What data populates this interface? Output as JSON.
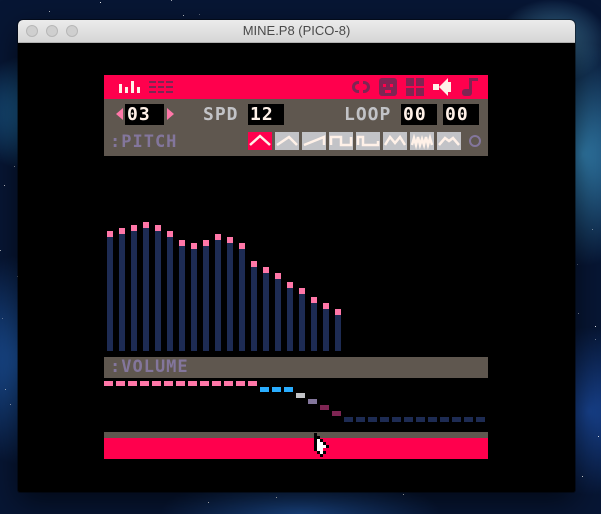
{
  "window": {
    "title": "MINE.P8 (PICO-8)"
  },
  "colors": {
    "red": "#ff004d",
    "dark_red": "#7e2553",
    "grey": "#5f574f",
    "light_grey": "#c2c3c7",
    "lavender": "#83769c",
    "white": "#fff1e8",
    "navy": "#1d2b53",
    "pink": "#ff77a8",
    "blue": "#29adff",
    "black": "#000000"
  },
  "toolbar": {
    "left_icons": [
      "sfx-editor-icon",
      "pattern-editor-icon"
    ],
    "right_icons": [
      "code-editor-icon",
      "sprite-editor-icon",
      "map-editor-icon",
      "sfx-icon",
      "music-icon"
    ]
  },
  "sfx": {
    "index": "03",
    "speed_label": "SPD",
    "speed_value": "12",
    "loop_label": "LOOP",
    "loop_start": "00",
    "loop_end": "00"
  },
  "pitch_section": {
    "label": ":PITCH"
  },
  "volume_section": {
    "label": ":VOLUME"
  },
  "instruments": {
    "selected": 0,
    "items": [
      "triangle",
      "tilted-saw",
      "saw",
      "square",
      "pulse",
      "organ",
      "noise",
      "phaser"
    ]
  },
  "pitch": [
    40,
    41,
    42,
    43,
    42,
    40,
    37,
    36,
    37,
    39,
    38,
    36,
    30,
    28,
    26,
    23,
    21,
    18,
    16,
    14
  ],
  "volume": [
    7,
    7,
    7,
    7,
    7,
    7,
    7,
    7,
    7,
    7,
    7,
    7,
    7,
    6,
    6,
    6,
    5,
    4,
    3,
    2,
    1,
    1,
    1,
    1,
    1,
    1,
    1,
    1,
    1,
    1,
    1,
    1
  ]
}
